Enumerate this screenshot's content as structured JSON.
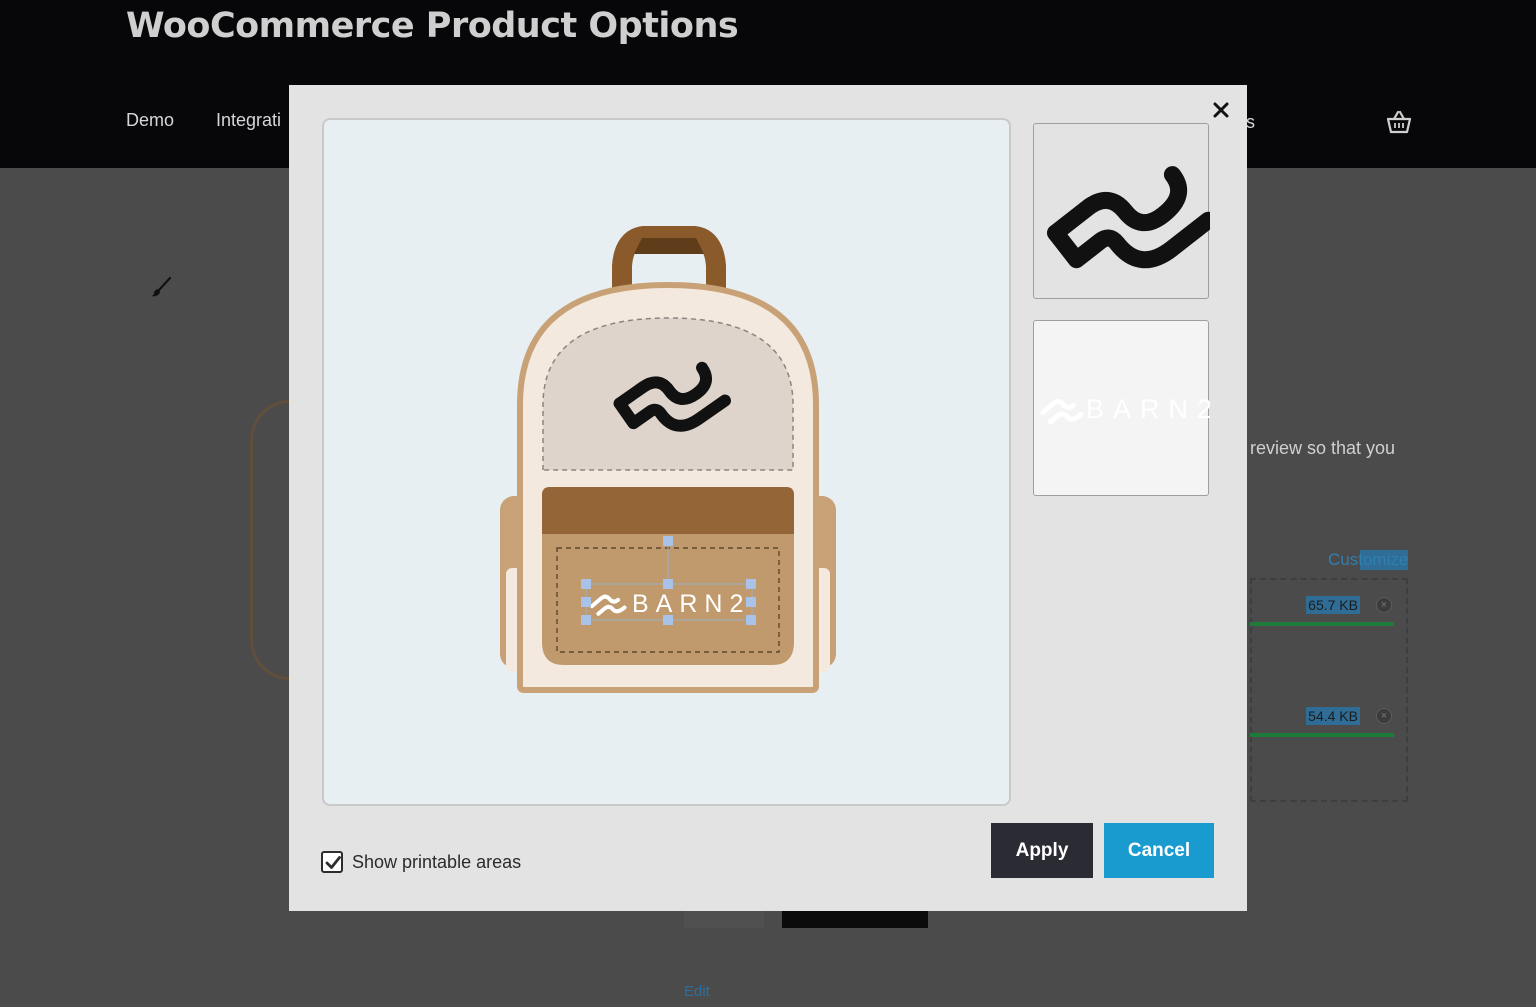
{
  "site": {
    "title": "WooCommerce Product Options",
    "nav": [
      "Demo",
      "Integrati"
    ],
    "nav_fragment": "s"
  },
  "background": {
    "description_fragment": "review so that you",
    "customize_link": "Customize",
    "files": [
      {
        "size": "65.7 KB"
      },
      {
        "size": "54.4 KB"
      }
    ],
    "edit_link": "Edit"
  },
  "modal": {
    "canvas_logo_text": "BARN2",
    "thumbnails": [
      {
        "name": "barn2-icon-logo"
      },
      {
        "name": "barn2-wordmark-logo",
        "text": "BARN2"
      }
    ],
    "show_printable_label": "Show printable areas",
    "show_printable_checked": true,
    "apply_label": "Apply",
    "cancel_label": "Cancel"
  },
  "colors": {
    "apply_bg": "#2b2b33",
    "cancel_bg": "#1a9bd0",
    "modal_bg": "#e3e3e3",
    "canvas_bg": "#e8eff3"
  }
}
